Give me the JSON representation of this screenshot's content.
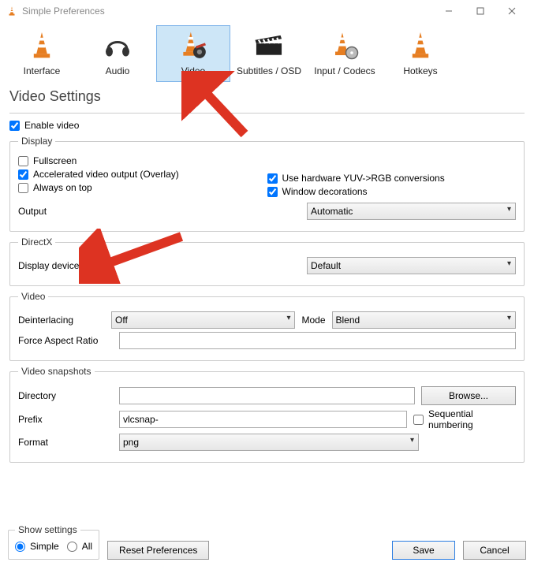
{
  "window": {
    "title": "Simple Preferences"
  },
  "tabs": [
    {
      "label": "Interface"
    },
    {
      "label": "Audio"
    },
    {
      "label": "Video"
    },
    {
      "label": "Subtitles / OSD"
    },
    {
      "label": "Input / Codecs"
    },
    {
      "label": "Hotkeys"
    }
  ],
  "heading": "Video Settings",
  "enable_video": {
    "label": "Enable video",
    "checked": true
  },
  "display": {
    "legend": "Display",
    "fullscreen": {
      "label": "Fullscreen",
      "checked": false
    },
    "accel": {
      "label": "Accelerated video output (Overlay)",
      "checked": true
    },
    "ontop": {
      "label": "Always on top",
      "checked": false
    },
    "yuv": {
      "label": "Use hardware YUV->RGB conversions",
      "checked": true
    },
    "windeco": {
      "label": "Window decorations",
      "checked": true
    },
    "output": {
      "label": "Output",
      "value": "Automatic"
    }
  },
  "directx": {
    "legend": "DirectX",
    "device": {
      "label": "Display device",
      "value": "Default"
    }
  },
  "video": {
    "legend": "Video",
    "deint": {
      "label": "Deinterlacing",
      "value": "Off"
    },
    "mode": {
      "label": "Mode",
      "value": "Blend"
    },
    "aspect": {
      "label": "Force Aspect Ratio",
      "value": ""
    }
  },
  "snapshots": {
    "legend": "Video snapshots",
    "directory": {
      "label": "Directory",
      "value": "",
      "browse": "Browse..."
    },
    "prefix": {
      "label": "Prefix",
      "value": "vlcsnap-"
    },
    "seq": {
      "label": "Sequential numbering",
      "checked": false
    },
    "format": {
      "label": "Format",
      "value": "png"
    }
  },
  "footer": {
    "show_legend": "Show settings",
    "simple": "Simple",
    "all": "All",
    "reset": "Reset Preferences",
    "save": "Save",
    "cancel": "Cancel"
  }
}
